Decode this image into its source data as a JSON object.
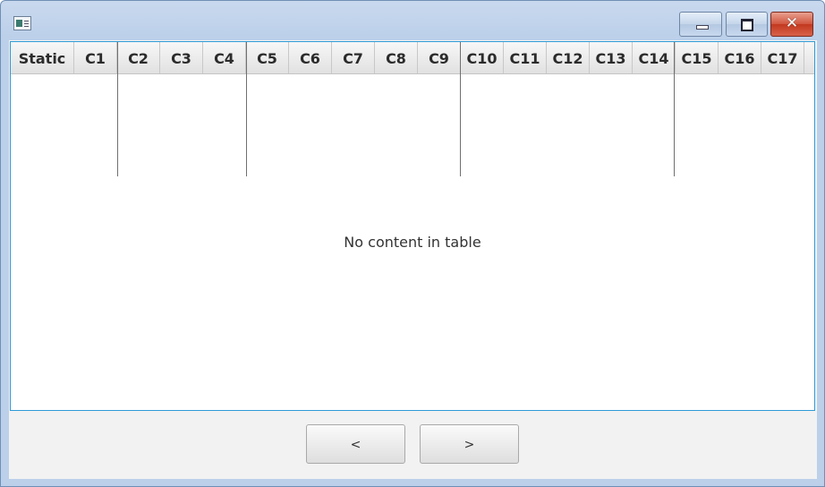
{
  "window": {
    "icon": "app-window-icon",
    "controls": {
      "minimize_icon": "minimize-icon",
      "maximize_icon": "maximize-icon",
      "close_label": "✕",
      "close_color": "#c8432a"
    }
  },
  "table": {
    "columns": [
      "Static",
      "C1",
      "C2",
      "C3",
      "C4",
      "C5",
      "C6",
      "C7",
      "C8",
      "C9",
      "C10",
      "C11",
      "C12",
      "C13",
      "C14",
      "C15",
      "C16",
      "C17"
    ],
    "empty_message": "No content in table",
    "border_color": "#2e9bd6"
  },
  "nav": {
    "prev_label": "<",
    "next_label": ">"
  }
}
